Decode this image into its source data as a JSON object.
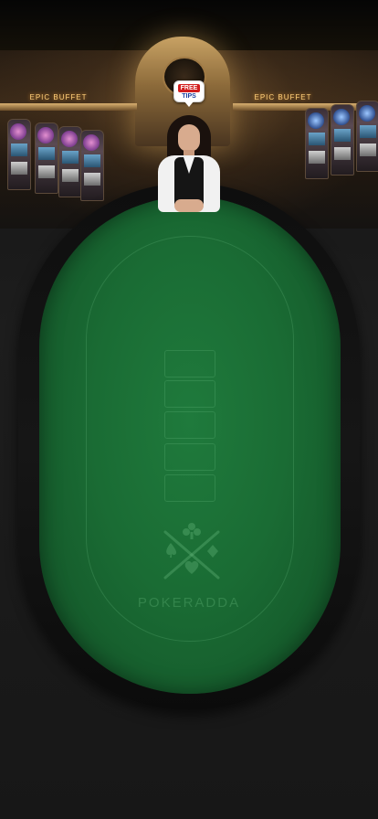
{
  "backdrop": {
    "sign_left": "EPIC BUFFET",
    "sign_right": "EPIC BUFFET"
  },
  "tips_badge": {
    "tag": "FREE",
    "label": "TIPS"
  },
  "table": {
    "card_slots": 5,
    "brand": "POKERADDA"
  },
  "colors": {
    "felt": "#1a6c34",
    "rail": "#121212",
    "felt_lines": "#78c88c"
  },
  "icons": {
    "emblem": "crossed-cues-card-suits-icon"
  }
}
